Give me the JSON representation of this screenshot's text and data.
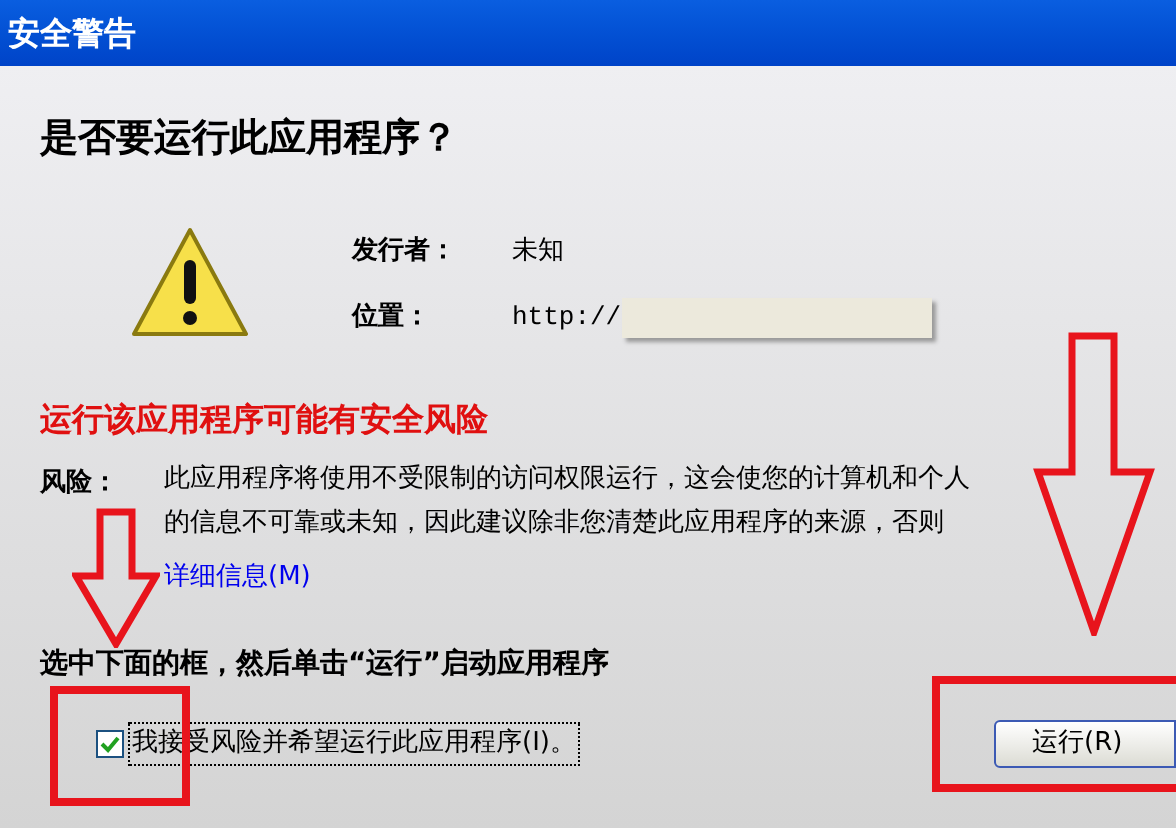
{
  "window": {
    "title": "安全警告"
  },
  "heading": "是否要运行此应用程序？",
  "details": [
    {
      "label": "发行者：",
      "value": "未知",
      "kind": "text"
    },
    {
      "label": "位置：",
      "value": "http://",
      "kind": "url"
    }
  ],
  "warning": {
    "title": "运行该应用程序可能有安全风险",
    "risk_label": "风险：",
    "risk_lines": [
      "此应用程序将使用不受限制的访问权限运行，这会使您的计算机和个人",
      "的信息不可靠或未知，因此建议除非您清楚此应用程序的来源，否则"
    ]
  },
  "link": "详细信息(M)",
  "instruction": "选中下面的框，然后单击“运行”启动应用程序",
  "checkbox": {
    "label": "我接受风险并希望运行此应用程序(I)。",
    "checked": true
  },
  "buttons": [
    {
      "label": "运行(R)"
    }
  ]
}
